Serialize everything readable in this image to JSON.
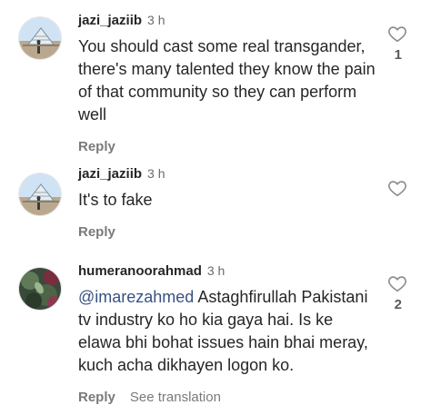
{
  "comments": [
    {
      "username": "jazi_jaziib",
      "time": "3 h",
      "text": "You should cast some real transgander, there's many talented they know the pain of that community so they can perform well",
      "mention": "",
      "reply_label": "Reply",
      "translate_label": "",
      "like_count": "1"
    },
    {
      "username": "jazi_jaziib",
      "time": "3 h",
      "text": "It's to fake",
      "mention": "",
      "reply_label": "Reply",
      "translate_label": "",
      "like_count": ""
    },
    {
      "username": "humeranoorahmad",
      "time": "3 h",
      "text": "Astaghfirullah Pakistani tv industry ko ho kia gaya hai. Is ke elawa bhi bohat issues hain bhai meray, kuch acha dikhayen logon ko.",
      "mention": "@imarezahmed",
      "reply_label": "Reply",
      "translate_label": "See translation",
      "like_count": "2"
    }
  ],
  "icons": {
    "like": "heart-outline-icon",
    "avatar_1": "pyramid-photo-avatar",
    "avatar_2": "flower-photo-avatar"
  },
  "colors": {
    "mention": "#385185",
    "secondary_text": "#7a7a7a"
  }
}
